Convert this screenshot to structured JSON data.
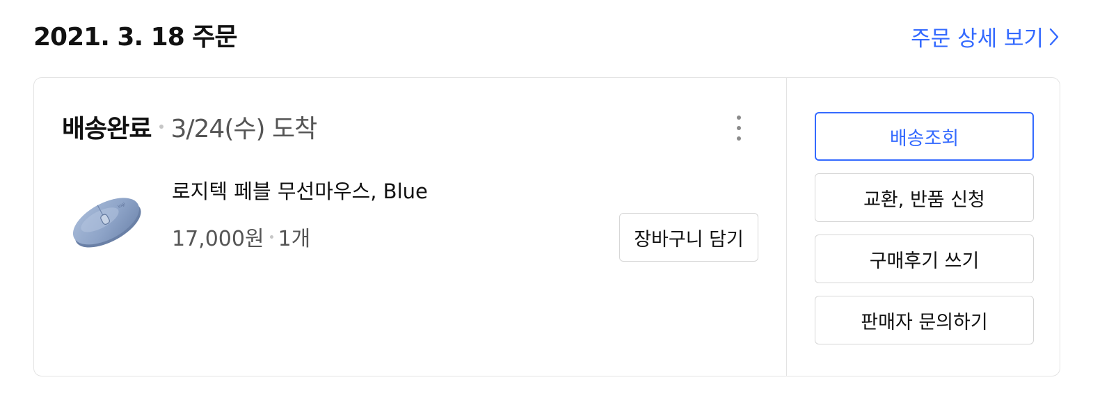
{
  "order": {
    "date_title": "2021. 3. 18 주문",
    "detail_link": "주문 상세 보기"
  },
  "shipment": {
    "status": "배송완료",
    "arrival": "3/24(수) 도착"
  },
  "product": {
    "name": "로지텍 페블 무선마우스, Blue",
    "price": "17,000원",
    "quantity": "1개",
    "image_icon": "mouse-product-image"
  },
  "buttons": {
    "add_to_cart": "장바구니 담기",
    "track_delivery": "배송조회",
    "exchange_return": "교환, 반품 신청",
    "write_review": "구매후기 쓰기",
    "seller_inquiry": "판매자 문의하기"
  },
  "colors": {
    "accent": "#346aff",
    "border": "#e3e3e3",
    "text_primary": "#111111",
    "text_secondary": "#555555"
  }
}
